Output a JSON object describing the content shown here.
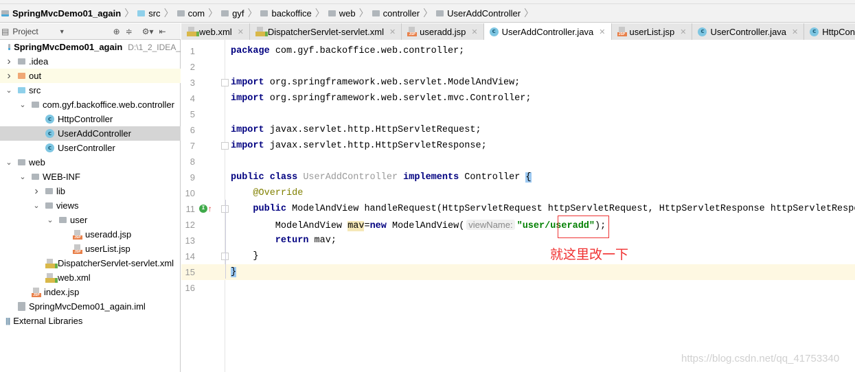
{
  "breadcrumb": [
    {
      "label": "SpringMvcDemo01_again",
      "icon": "module-icon",
      "bold": true
    },
    {
      "label": "src",
      "icon": "folder-src-icon"
    },
    {
      "label": "com",
      "icon": "package-icon"
    },
    {
      "label": "gyf",
      "icon": "package-icon"
    },
    {
      "label": "backoffice",
      "icon": "package-icon"
    },
    {
      "label": "web",
      "icon": "package-icon"
    },
    {
      "label": "controller",
      "icon": "package-icon"
    },
    {
      "label": "UserAddController",
      "icon": "class-icon"
    }
  ],
  "sidebar": {
    "title": "Project",
    "tree": [
      {
        "label": "SpringMvcDemo01_again",
        "suffix": "D:\\1_2_IDEA_",
        "level": 0,
        "icon": "module",
        "bold": true
      },
      {
        "label": ".idea",
        "level": 0,
        "icon": "folder",
        "arrow": "right"
      },
      {
        "label": "out",
        "level": 0,
        "icon": "folder-orange",
        "arrow": "right",
        "hl": true
      },
      {
        "label": "src",
        "level": 0,
        "icon": "folder-blue",
        "arrow": "down"
      },
      {
        "label": "com.gyf.backoffice.web.controller",
        "level": 1,
        "icon": "folder",
        "arrow": "down"
      },
      {
        "label": "HttpController",
        "level": 2,
        "icon": "class"
      },
      {
        "label": "UserAddController",
        "level": 2,
        "icon": "class",
        "selected": true
      },
      {
        "label": "UserController",
        "level": 2,
        "icon": "class"
      },
      {
        "label": "web",
        "level": 0,
        "icon": "folder",
        "arrow": "down"
      },
      {
        "label": "WEB-INF",
        "level": 1,
        "icon": "folder",
        "arrow": "down"
      },
      {
        "label": "lib",
        "level": 2,
        "icon": "folder",
        "arrow": "right"
      },
      {
        "label": "views",
        "level": 2,
        "icon": "folder",
        "arrow": "down"
      },
      {
        "label": "user",
        "level": 3,
        "icon": "folder",
        "arrow": "down"
      },
      {
        "label": "useradd.jsp",
        "level": 4,
        "icon": "jsp"
      },
      {
        "label": "userList.jsp",
        "level": 4,
        "icon": "jsp"
      },
      {
        "label": "DispatcherServlet-servlet.xml",
        "level": 2,
        "icon": "xml"
      },
      {
        "label": "web.xml",
        "level": 2,
        "icon": "xml"
      },
      {
        "label": "index.jsp",
        "level": 1,
        "icon": "jsp"
      },
      {
        "label": "SpringMvcDemo01_again.iml",
        "level": 0,
        "icon": "iml"
      },
      {
        "label": "External Libraries",
        "level": -1,
        "icon": "libraries"
      }
    ]
  },
  "tabs": [
    {
      "label": "web.xml",
      "icon": "xml"
    },
    {
      "label": "DispatcherServlet-servlet.xml",
      "icon": "xml"
    },
    {
      "label": "useradd.jsp",
      "icon": "jsp"
    },
    {
      "label": "UserAddController.java",
      "icon": "class",
      "active": true
    },
    {
      "label": "userList.jsp",
      "icon": "jsp"
    },
    {
      "label": "UserController.java",
      "icon": "class"
    },
    {
      "label": "HttpContro",
      "icon": "class",
      "cut": true
    }
  ],
  "code": [
    [
      [
        "kw",
        "package"
      ],
      [
        "",
        "com.gyf.backoffice.web.controller;"
      ]
    ],
    [],
    [
      [
        "kw",
        "import"
      ],
      [
        "",
        "org.springframework.web.servlet.ModelAndView;"
      ]
    ],
    [
      [
        "kw",
        "import"
      ],
      [
        "",
        "org.springframework.web.servlet.mvc.Controller;"
      ]
    ],
    [],
    [
      [
        "kw",
        "import"
      ],
      [
        "",
        "javax.servlet.http.HttpServletRequest;"
      ]
    ],
    [
      [
        "kw",
        "import"
      ],
      [
        "",
        "javax.servlet.http.HttpServletResponse;"
      ]
    ],
    [],
    [
      [
        "kw",
        "public class"
      ],
      [
        "unused",
        "UserAddController"
      ],
      [
        "kw",
        "implements"
      ],
      [
        "",
        "Controller"
      ],
      [
        "brace",
        "{"
      ]
    ],
    [
      [
        "ann",
        "    @Override"
      ]
    ],
    [
      [
        "kw",
        "    public"
      ],
      [
        "",
        "ModelAndView handleRequest(HttpServletRequest httpServletRequest, HttpServletResponse httpServletResponse)"
      ]
    ],
    [
      [
        "",
        "        ModelAndView"
      ],
      [
        "var",
        "mav"
      ],
      [
        "nsp",
        "="
      ],
      [
        "kw",
        "new"
      ],
      [
        "nsp",
        " ModelAndView("
      ],
      [
        "hint",
        "viewName:"
      ],
      [
        "str",
        "\"user/useradd\""
      ],
      [
        "nsp",
        ");"
      ]
    ],
    [
      [
        "kw",
        "        return"
      ],
      [
        "",
        "mav;"
      ]
    ],
    [
      [
        "",
        "    }"
      ]
    ],
    [
      [
        "brace",
        "}"
      ]
    ],
    []
  ],
  "current_line": 15,
  "annotation": {
    "note": "就这里改一下",
    "color": "#f03030"
  },
  "watermark": "https://blog.csdn.net/qq_41753340"
}
